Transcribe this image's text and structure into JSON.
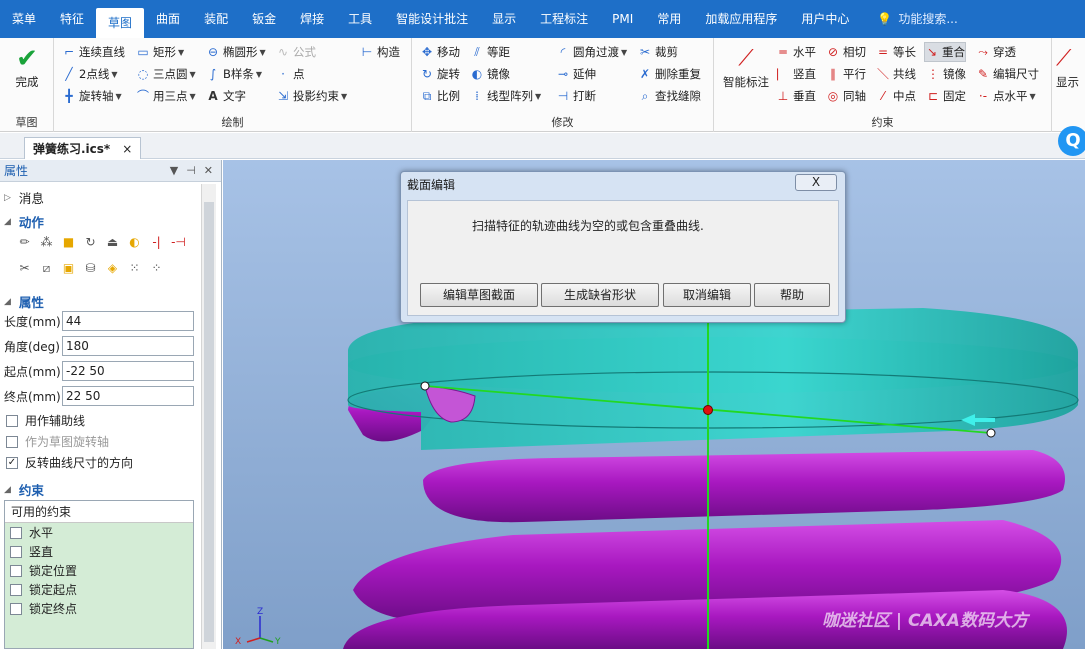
{
  "menu": {
    "items": [
      "菜单",
      "特征",
      "草图",
      "曲面",
      "装配",
      "钣金",
      "焊接",
      "工具",
      "智能设计批注",
      "显示",
      "工程标注",
      "PMI",
      "常用",
      "加载应用程序",
      "用户中心"
    ],
    "active_index": 2,
    "search_placeholder": "功能搜索..."
  },
  "ribbon": {
    "finish": {
      "label": "完成",
      "group": "草图"
    },
    "draw": {
      "group": "绘制",
      "items": [
        "连续直线",
        "矩形",
        "椭圆形",
        "公式",
        "构造",
        "2点线",
        "三点圆",
        "B样条",
        "点",
        "旋转轴",
        "用三点",
        "文字",
        "投影约束"
      ]
    },
    "modify": {
      "group": "修改",
      "items": [
        "移动",
        "等距",
        "圆角过渡",
        "裁剪",
        "旋转",
        "镜像",
        "延伸",
        "删除重复",
        "比例",
        "线型阵列",
        "打断",
        "查找缝隙"
      ]
    },
    "constraint": {
      "group": "约束",
      "smart": "智能标注",
      "items": [
        "水平",
        "相切",
        "等长",
        "重合",
        "穿透",
        "竖直",
        "平行",
        "共线",
        "镜像",
        "编辑尺寸",
        "垂直",
        "同轴",
        "中点",
        "固定",
        "点水平"
      ]
    },
    "display": {
      "label": "显示",
      "group": "显示"
    }
  },
  "document_tab": {
    "title": "弹簧练习.ics*",
    "close": "×"
  },
  "panel": {
    "title": "属性",
    "controls": [
      "▼",
      "⊣",
      "✕"
    ],
    "sections": {
      "messages": "消息",
      "actions": "动作",
      "properties": "属性",
      "constraints": "约束"
    },
    "props": [
      {
        "label": "长度(mm)",
        "value": "44"
      },
      {
        "label": "角度(deg)",
        "value": "180"
      },
      {
        "label": "起点(mm)",
        "value": "-22 50"
      },
      {
        "label": "终点(mm)",
        "value": "22 50"
      }
    ],
    "checks": [
      {
        "label": "用作辅助线",
        "checked": false,
        "disabled": false
      },
      {
        "label": "作为草图旋转轴",
        "checked": false,
        "disabled": true
      },
      {
        "label": "反转曲线尺寸的方向",
        "checked": true,
        "disabled": false
      }
    ],
    "constraints_header": "可用的约束",
    "constraints": [
      "水平",
      "竖直",
      "锁定位置",
      "锁定起点",
      "锁定终点"
    ]
  },
  "dialog": {
    "title": "截面编辑",
    "close": "X",
    "message": "扫描特征的轨迹曲线为空的或包含重叠曲线.",
    "buttons": [
      "编辑草图截面",
      "生成缺省形状",
      "取消编辑",
      "帮助"
    ]
  },
  "axes": {
    "z": "Z",
    "x": "X",
    "y": "Y"
  },
  "watermark": "咖迷社区 | CAXA数码大方",
  "colors": {
    "menubar": "#1e6fc8",
    "spring": "#b020c8",
    "plate": "#30c8c0",
    "sketch_line": "#22cc22",
    "point": "#e01010"
  }
}
